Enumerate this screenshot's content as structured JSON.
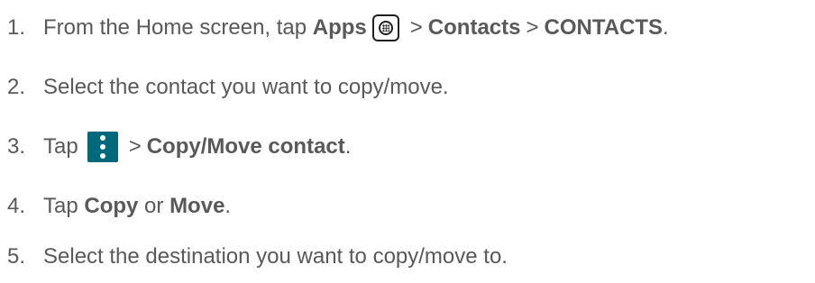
{
  "steps": [
    {
      "num": "1.",
      "t1": "From the Home screen, tap ",
      "b1": "Apps",
      "icon": "apps-launcher-icon",
      "sep1": ">",
      "b2": "Contacts",
      "sep2": ">",
      "b3": "CONTACTS",
      "end": "."
    },
    {
      "num": "2.",
      "text": "Select the contact you want to copy/move."
    },
    {
      "num": "3.",
      "t1": "Tap",
      "icon": "overflow-menu-icon",
      "sep1": ">",
      "b1": "Copy/Move contact",
      "end": "."
    },
    {
      "num": "4.",
      "t1": "Tap ",
      "b1": "Copy",
      "t2": " or ",
      "b2": "Move",
      "end": "."
    },
    {
      "num": "5.",
      "text": "Select the destination you want to copy/move to."
    }
  ],
  "colors": {
    "text": "#595959",
    "menu_icon_bg": "#00687a"
  }
}
